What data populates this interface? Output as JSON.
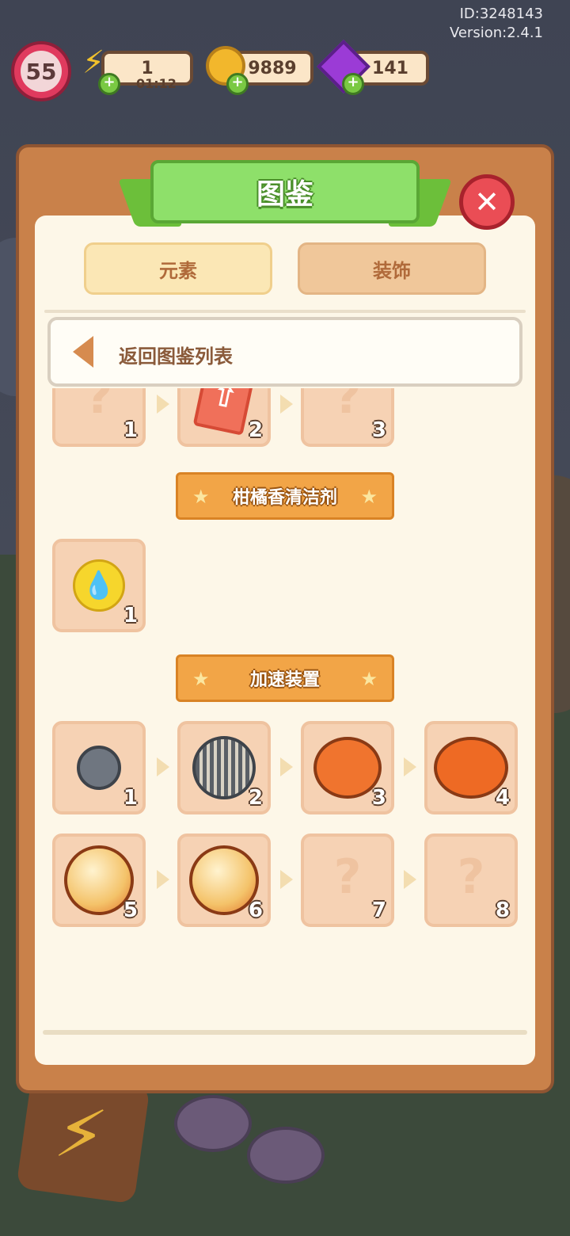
{
  "header": {
    "id_text": "ID:3248143",
    "version_text": "Version:2.4.1"
  },
  "status": {
    "level": "55",
    "energy": {
      "value": "1",
      "timer": "01:12"
    },
    "coins": {
      "value": "9889"
    },
    "gems": {
      "value": "141"
    }
  },
  "modal": {
    "title": "图鉴",
    "tabs": [
      {
        "label": "元素"
      },
      {
        "label": "装饰"
      }
    ],
    "back_label": "返回图鉴列表",
    "top_row": [
      {
        "num": "1",
        "unlocked": false
      },
      {
        "num": "2",
        "unlocked": true
      },
      {
        "num": "3",
        "unlocked": false
      }
    ],
    "categories": [
      {
        "name": "柑橘香清洁剂",
        "items": [
          {
            "num": "1",
            "unlocked": true
          }
        ]
      },
      {
        "name": "加速装置",
        "items": [
          {
            "num": "1",
            "unlocked": true
          },
          {
            "num": "2",
            "unlocked": true
          },
          {
            "num": "3",
            "unlocked": true
          },
          {
            "num": "4",
            "unlocked": true
          },
          {
            "num": "5",
            "unlocked": true
          },
          {
            "num": "6",
            "unlocked": true
          },
          {
            "num": "7",
            "unlocked": false
          },
          {
            "num": "8",
            "unlocked": false
          }
        ]
      }
    ]
  }
}
